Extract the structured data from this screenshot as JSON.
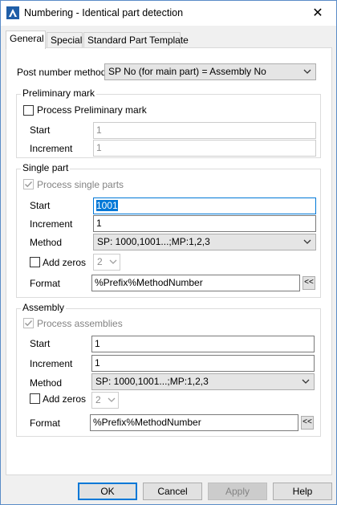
{
  "window": {
    "title": "Numbering - Identical part detection",
    "close_glyph": "✕"
  },
  "tabs": [
    "General",
    "Special",
    "Standard Part Template"
  ],
  "post_number": {
    "label": "Post number method",
    "value": "SP No (for main part) = Assembly No"
  },
  "preliminary": {
    "title": "Preliminary mark",
    "process_label": "Process Preliminary mark",
    "process_checked": false,
    "start_label": "Start",
    "start_value": "1",
    "increment_label": "Increment",
    "increment_value": "1"
  },
  "single_part": {
    "title": "Single part",
    "process_label": "Process single parts",
    "process_checked": true,
    "start_label": "Start",
    "start_value": "1001",
    "increment_label": "Increment",
    "increment_value": "1",
    "method_label": "Method",
    "method_value": "SP: 1000,1001...;MP:1,2,3",
    "add_zeros_label": "Add zeros",
    "add_zeros_checked": false,
    "zeros_value": "2",
    "format_label": "Format",
    "format_value": "%Prefix%MethodNumber",
    "format_button": "<<"
  },
  "assembly": {
    "title": "Assembly",
    "process_label": "Process assemblies",
    "process_checked": true,
    "start_label": "Start",
    "start_value": "1",
    "increment_label": "Increment",
    "increment_value": "1",
    "method_label": "Method",
    "method_value": "SP: 1000,1001...;MP:1,2,3",
    "add_zeros_label": "Add zeros",
    "add_zeros_checked": false,
    "zeros_value": "2",
    "format_label": "Format",
    "format_value": "%Prefix%MethodNumber",
    "format_button": "<<"
  },
  "buttons": {
    "ok": "OK",
    "cancel": "Cancel",
    "apply": "Apply",
    "help": "Help"
  },
  "colors": {
    "accent": "#0078d7",
    "app_icon": "#1f5ea8",
    "disabled_text": "#838383"
  },
  "icons": {
    "app": "autocad-app-icon",
    "dropdown": "chevron-down-icon",
    "check": "checkmark-icon",
    "close": "close-icon"
  }
}
